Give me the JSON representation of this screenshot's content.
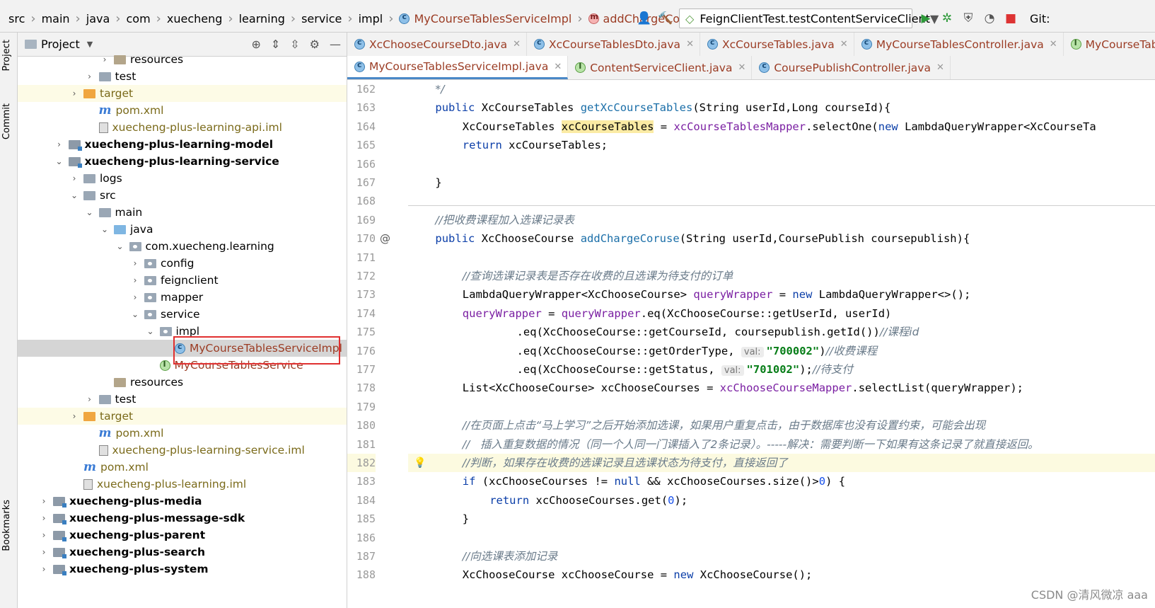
{
  "breadcrumb": [
    "src",
    "main",
    "java",
    "com",
    "xuecheng",
    "learning",
    "service",
    "impl"
  ],
  "breadcrumb_file": "MyCourseTablesServiceImpl",
  "breadcrumb_method": "addChargeCoruse",
  "run_config": "FeignClientTest.testContentServiceClient",
  "git_label": "Git:",
  "project_panel": {
    "title": "Project"
  },
  "left_tabs": [
    "Project",
    "Commit",
    "Bookmarks"
  ],
  "tree": [
    {
      "label": "resources",
      "kind": "folder-res",
      "indent": 6,
      "arrow": "▸",
      "y": 0
    },
    {
      "label": "test",
      "kind": "folder",
      "indent": 5,
      "arrow": "▸",
      "y": 1
    },
    {
      "label": "target",
      "kind": "folder-orange",
      "indent": 4,
      "arrow": "▸",
      "y": 2
    },
    {
      "label": "pom.xml",
      "kind": "maven",
      "indent": 5,
      "arrow": "",
      "y": 3
    },
    {
      "label": "xuecheng-plus-learning-api.iml",
      "kind": "iml",
      "indent": 5,
      "arrow": "",
      "y": 4
    },
    {
      "label": "xuecheng-plus-learning-model",
      "kind": "module",
      "indent": 3,
      "arrow": "▸",
      "y": 5
    },
    {
      "label": "xuecheng-plus-learning-service",
      "kind": "module",
      "indent": 3,
      "arrow": "▾",
      "y": 6
    },
    {
      "label": "logs",
      "kind": "folder",
      "indent": 4,
      "arrow": "▸",
      "y": 7
    },
    {
      "label": "src",
      "kind": "folder",
      "indent": 4,
      "arrow": "▾",
      "y": 8
    },
    {
      "label": "main",
      "kind": "folder",
      "indent": 5,
      "arrow": "▾",
      "y": 9
    },
    {
      "label": "java",
      "kind": "folder-blue",
      "indent": 6,
      "arrow": "▾",
      "y": 10
    },
    {
      "label": "com.xuecheng.learning",
      "kind": "package",
      "indent": 7,
      "arrow": "▾",
      "y": 11
    },
    {
      "label": "config",
      "kind": "package",
      "indent": 8,
      "arrow": "▸",
      "y": 12
    },
    {
      "label": "feignclient",
      "kind": "package",
      "indent": 8,
      "arrow": "▸",
      "y": 13
    },
    {
      "label": "mapper",
      "kind": "package",
      "indent": 8,
      "arrow": "▸",
      "y": 14
    },
    {
      "label": "service",
      "kind": "package",
      "indent": 8,
      "arrow": "▾",
      "y": 15
    },
    {
      "label": "impl",
      "kind": "package",
      "indent": 9,
      "arrow": "▾",
      "y": 16
    },
    {
      "label": "MyCourseTablesServiceImpl",
      "kind": "class",
      "indent": 10,
      "arrow": "",
      "y": 17
    },
    {
      "label": "MyCourseTablesService",
      "kind": "interface",
      "indent": 9,
      "arrow": "",
      "y": 18
    },
    {
      "label": "resources",
      "kind": "folder-res",
      "indent": 6,
      "arrow": "",
      "y": 19
    },
    {
      "label": "test",
      "kind": "folder",
      "indent": 5,
      "arrow": "▸",
      "y": 20
    },
    {
      "label": "target",
      "kind": "folder-orange",
      "indent": 4,
      "arrow": "▸",
      "y": 21
    },
    {
      "label": "pom.xml",
      "kind": "maven",
      "indent": 5,
      "arrow": "",
      "y": 22
    },
    {
      "label": "xuecheng-plus-learning-service.iml",
      "kind": "iml",
      "indent": 5,
      "arrow": "",
      "y": 23
    },
    {
      "label": "pom.xml",
      "kind": "maven",
      "indent": 4,
      "arrow": "",
      "y": 24
    },
    {
      "label": "xuecheng-plus-learning.iml",
      "kind": "iml",
      "indent": 4,
      "arrow": "",
      "y": 25
    },
    {
      "label": "xuecheng-plus-media",
      "kind": "module",
      "indent": 2,
      "arrow": "▸",
      "y": 26
    },
    {
      "label": "xuecheng-plus-message-sdk",
      "kind": "module",
      "indent": 2,
      "arrow": "▸",
      "y": 27
    },
    {
      "label": "xuecheng-plus-parent",
      "kind": "module",
      "indent": 2,
      "arrow": "▸",
      "y": 28
    },
    {
      "label": "xuecheng-plus-search",
      "kind": "module",
      "indent": 2,
      "arrow": "▸",
      "y": 29
    },
    {
      "label": "xuecheng-plus-system",
      "kind": "module",
      "indent": 2,
      "arrow": "▸",
      "y": 30
    }
  ],
  "tabs_row1": [
    {
      "label": "XcChooseCourseDto.java",
      "icon": "c"
    },
    {
      "label": "XcCourseTablesDto.java",
      "icon": "c"
    },
    {
      "label": "XcCourseTables.java",
      "icon": "c"
    },
    {
      "label": "MyCourseTablesController.java",
      "icon": "c"
    },
    {
      "label": "MyCourseTabl",
      "icon": "i"
    }
  ],
  "tabs_row2": [
    {
      "label": "MyCourseTablesServiceImpl.java",
      "icon": "c",
      "active": true
    },
    {
      "label": "ContentServiceClient.java",
      "icon": "i"
    },
    {
      "label": "CoursePublishController.java",
      "icon": "c"
    }
  ],
  "line_numbers": [
    "162",
    "163",
    "164",
    "165",
    "166",
    "167",
    "168",
    "169",
    "170",
    "171",
    "172",
    "173",
    "174",
    "175",
    "176",
    "177",
    "178",
    "179",
    "180",
    "181",
    "182",
    "183",
    "184",
    "185",
    "186",
    "187",
    "188"
  ],
  "code": {
    "l162": "*/",
    "l163": [
      "public",
      " XcCourseTables ",
      "getXcCourseTables",
      "(String userId,Long courseId){"
    ],
    "l164": [
      "XcCourseTables ",
      "xcCourseTables",
      " = ",
      "xcCourseTablesMapper",
      ".selectOne(",
      "new",
      " LambdaQueryWrapper<XcCourseTa"
    ],
    "l165": [
      "return",
      " xcCourseTables;"
    ],
    "l167": "}",
    "l169": "//把收费课程加入选课记录表",
    "l170": [
      "public",
      " XcChooseCourse ",
      "addChargeCoruse",
      "(String userId,CoursePublish coursepublish){"
    ],
    "l170_mark": "@",
    "l172": "//查询选课记录表是否存在收费的且选课为待支付的订单",
    "l173": [
      "LambdaQueryWrapper<XcChooseCourse> ",
      "queryWrapper",
      " = ",
      "new",
      " LambdaQueryWrapper<>();"
    ],
    "l174": [
      "queryWrapper",
      " = ",
      "queryWrapper",
      ".eq(XcChooseCourse::getUserId, userId)"
    ],
    "l175": [
      ".eq(XcChooseCourse::getCourseId, coursepublish.getId())",
      "//课程id"
    ],
    "l176": [
      ".eq(XcChooseCourse::getOrderType, ",
      "val:",
      "\"700002\"",
      ")",
      "//收费课程"
    ],
    "l177": [
      ".eq(XcChooseCourse::getStatus, ",
      "val:",
      "\"701002\"",
      ");",
      "//待支付"
    ],
    "l178": [
      "List<XcChooseCourse> xcChooseCourses = ",
      "xcChooseCourseMapper",
      ".selectList(queryWrapper);"
    ],
    "l180": "//在页面上点击“马上学习”之后开始添加选课，如果用户重复点击，由于数据库也没有设置约束，可能会出现",
    "l181": "//   插入重复数据的情况（同一个人同一门课插入了2条记录）。-----解决：需要判断一下如果有这条记录了就直接返回。",
    "l182": "//判断，如果存在收费的选课记录且选课状态为待支付，直接返回了",
    "l183": [
      "if",
      " (xcChooseCourses != ",
      "null",
      " && xcChooseCourses.size()>",
      "0",
      ") {"
    ],
    "l184": [
      "return",
      " xcChooseCourses.get(",
      "0",
      ");"
    ],
    "l185": "}",
    "l187": "//向选课表添加记录",
    "l188": [
      "XcChooseCourse xcChooseCourse = ",
      "new",
      " XcChooseCourse();"
    ]
  },
  "watermark": "CSDN @清风微凉 aaa"
}
